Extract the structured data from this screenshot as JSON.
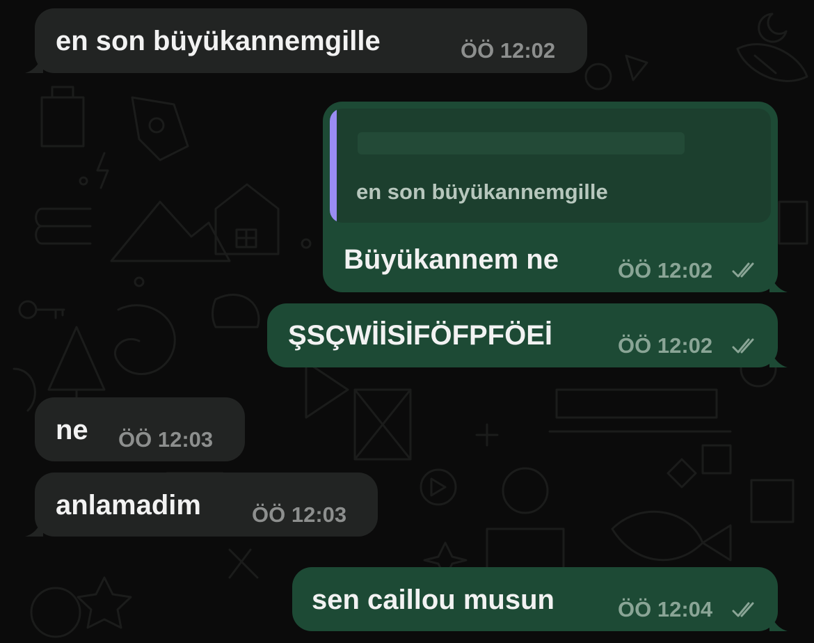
{
  "colors": {
    "background": "#0b0b0b",
    "incoming_bubble": "#222423",
    "outgoing_bubble": "#1d4a35",
    "quote_background": "#1c3f2e",
    "quote_accent": "#9a8cf2",
    "message_text": "#f2f2f2",
    "time_incoming": "#8d8f8e",
    "time_outgoing": "#8aa596"
  },
  "messages": [
    {
      "direction": "incoming",
      "text": "en son büyükannemgille",
      "time": "ÖÖ 12:02"
    },
    {
      "direction": "outgoing",
      "reply_to": {
        "text": "en son büyükannemgille"
      },
      "text": "Büyükannem ne",
      "time": "ÖÖ 12:02",
      "status_icon": "double-check-icon"
    },
    {
      "direction": "outgoing",
      "text": "ŞSÇWİİSİFÖFPFÖEİ",
      "time": "ÖÖ 12:02",
      "status_icon": "double-check-icon"
    },
    {
      "direction": "incoming",
      "text": "ne",
      "time": "ÖÖ 12:03"
    },
    {
      "direction": "incoming",
      "text": "anlamadim",
      "time": "ÖÖ 12:03"
    },
    {
      "direction": "outgoing",
      "text": "sen caillou musun",
      "time": "ÖÖ 12:04",
      "status_icon": "double-check-icon"
    }
  ]
}
